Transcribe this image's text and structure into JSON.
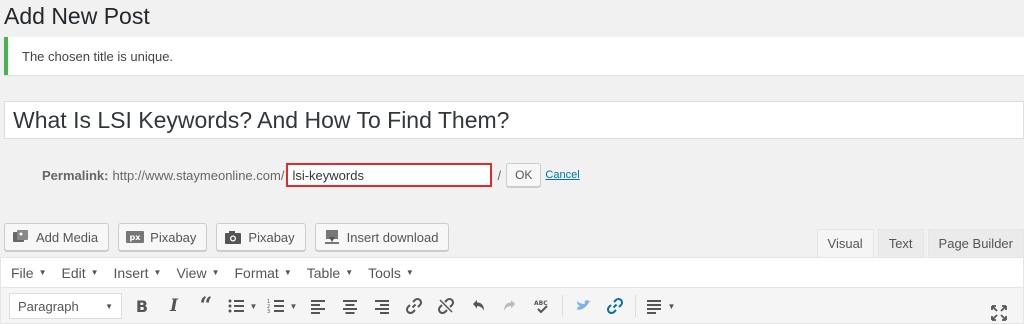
{
  "page": {
    "title": "Add New Post"
  },
  "notice": {
    "message": "The chosen title is unique."
  },
  "post": {
    "title": "What Is LSI Keywords? And How To Find Them?"
  },
  "permalink": {
    "label": "Permalink:",
    "base_url": "http://www.staymeonline.com/",
    "slug": "lsi-keywords",
    "slash": "/",
    "ok_label": "OK",
    "cancel_label": "Cancel"
  },
  "media_buttons": [
    {
      "label": "Add Media",
      "icon": "add-media-icon"
    },
    {
      "label": "Pixabay",
      "icon": "pixabay-px-icon"
    },
    {
      "label": "Pixabay",
      "icon": "camera-icon"
    },
    {
      "label": "Insert download",
      "icon": "download-icon"
    }
  ],
  "editor_tabs": [
    {
      "label": "Visual",
      "active": true
    },
    {
      "label": "Text",
      "active": false
    },
    {
      "label": "Page Builder",
      "active": false
    }
  ],
  "menubar": [
    "File",
    "Edit",
    "Insert",
    "View",
    "Format",
    "Table",
    "Tools"
  ],
  "toolbar": {
    "format_value": "Paragraph"
  },
  "colors": {
    "notice_border": "#46b450",
    "highlight": "#e22a2a",
    "link": "#0073aa"
  }
}
